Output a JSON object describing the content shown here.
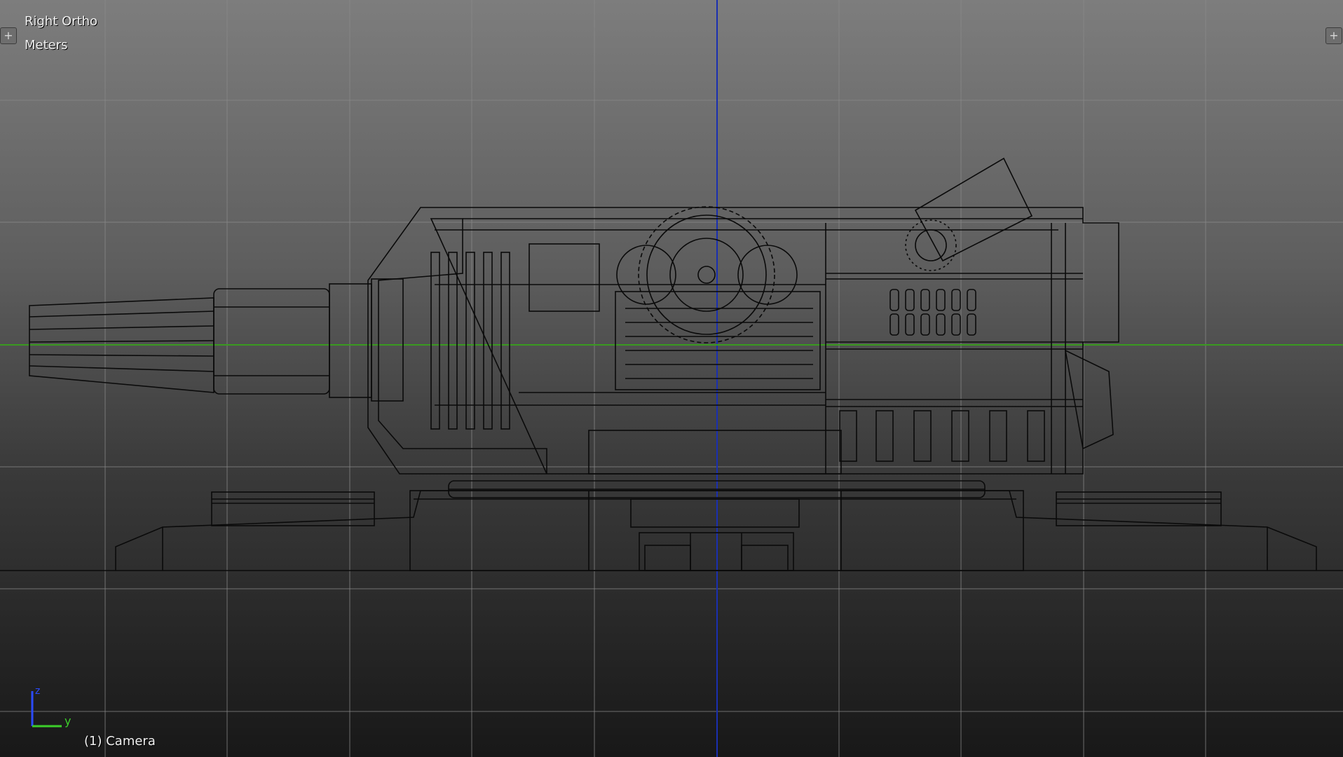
{
  "viewport": {
    "view_name": "Right Ortho",
    "units": "Meters",
    "active_object": "(1) Camera",
    "axis_gizmo": {
      "vertical_label": "z",
      "horizontal_label": "y"
    },
    "colors": {
      "background_top": "#7d7d7d",
      "background_bottom": "#181818",
      "grid_line": "#8a8a8a",
      "vertical_axis": "#1a2fb0",
      "horizontal_axis": "#3a9a20",
      "wire": "#0a0a0a"
    },
    "icons": [
      "view-corner-plus-icon-left",
      "view-corner-plus-icon-right"
    ]
  }
}
